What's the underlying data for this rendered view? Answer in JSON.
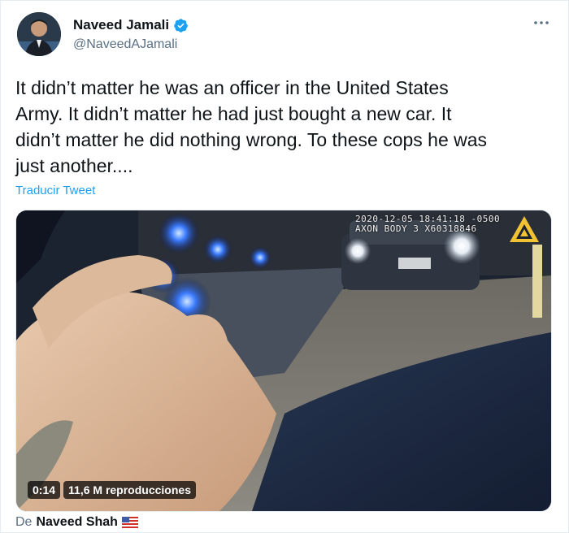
{
  "author": {
    "name": "Naveed Jamali",
    "handle": "@NaveedAJamali",
    "verified": true,
    "avatar_icon": "profile-photo-avatar"
  },
  "tweet": {
    "text": "It didn’t matter he was an officer in the United States\nArmy. It didn’t matter he had just bought a new car. It\ndidn’t matter he did nothing wrong. To these cops he was\njust another....",
    "translate_label": "Traducir Tweet"
  },
  "media": {
    "timestamp_line1": "2020-12-05 18:41:18 -0500",
    "timestamp_line2": "AXON BODY 3 X60318846",
    "duration": "0:14",
    "views": "11,6 M reproducciones"
  },
  "attribution": {
    "prefix": "De",
    "source_name": "Naveed Shah",
    "flag_icon": "us-flag-icon"
  },
  "colors": {
    "accent": "#1da1f2",
    "secondary_text": "#5b7083",
    "primary_text": "#0f1419"
  },
  "icons": {
    "more": "more-horizontal-icon",
    "verified": "verified-badge-icon",
    "axon": "axon-logo-icon"
  }
}
